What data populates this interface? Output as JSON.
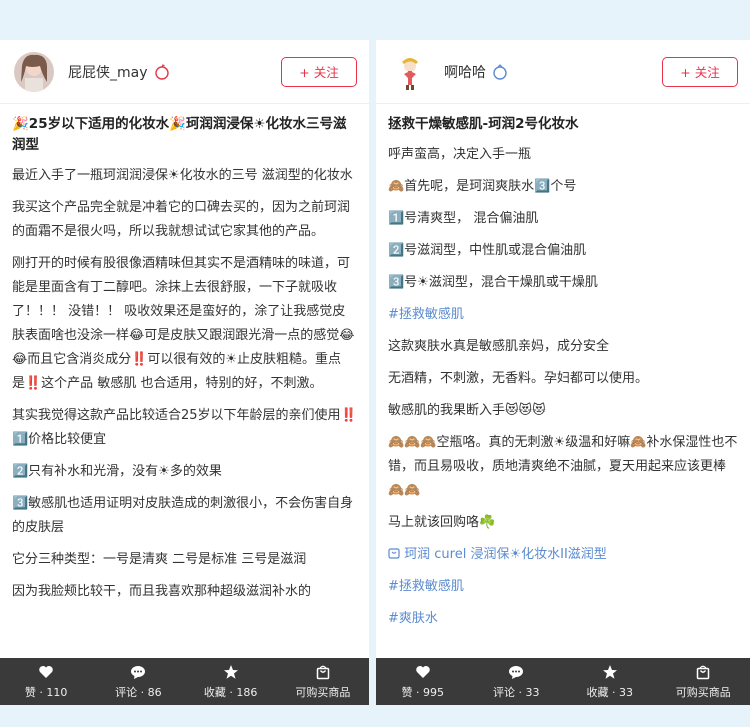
{
  "left": {
    "username": "屁屁侠_may",
    "follow_label": "+ 关注",
    "title": "🎉25岁以下适用的化妆水🎉珂润润浸保☀化妆水三号滋润型",
    "paragraphs": [
      "最近入手了一瓶珂润润浸保☀化妆水的三号 滋润型的化妆水",
      "我买这个产品完全就是冲着它的口碑去买的，因为之前珂润的面霜不是很火吗，所以我就想试试它家其他的产品。",
      "刚打开的时候有股很像酒精味但其实不是酒精味的味道，可能是里面含有丁二醇吧。涂抹上去很舒服，一下子就吸收了！！！ 没错！！ 吸收效果还是蛮好的，涂了让我感觉皮肤表面啥也没涂一样😂可是皮肤又跟润跟光滑一点的感觉😂😂而且它含消炎成分‼️可以很有效的☀止皮肤粗糙。重点是‼️这个产品 敏感肌 也合适用，特别的好，不刺激。",
      "其实我觉得这款产品比较适合25岁以下年龄层的亲们使用‼️1️⃣价格比较便宜",
      "2️⃣只有补水和光滑，没有☀多的效果",
      "3️⃣敏感肌也适用证明对皮肤造成的刺激很小，不会伤害自身的皮肤层",
      "它分三种类型：一号是清爽 二号是标准 三号是滋润",
      "因为我脸颊比较干，而且我喜欢那种超级滋润补水的"
    ],
    "footer": [
      {
        "icon": "heart-icon",
        "label": "赞 · 110"
      },
      {
        "icon": "comment-icon",
        "label": "评论 · 86"
      },
      {
        "icon": "star-icon",
        "label": "收藏 · 186"
      },
      {
        "icon": "shopping-bag-icon",
        "label": "可购买商品"
      }
    ]
  },
  "right": {
    "username": "啊哈哈",
    "follow_label": "+ 关注",
    "title": "拯救干燥敏感肌-珂润2号化妆水",
    "paragraphs": [
      "呼声蛮高，决定入手一瓶",
      "🙈首先呢，是珂润爽肤水3️⃣个号",
      "1️⃣号清爽型， 混合偏油肌",
      "2️⃣号滋润型，中性肌或混合偏油肌",
      "3️⃣号☀滋润型，混合干燥肌或干燥肌"
    ],
    "tag1": "#拯救敏感肌",
    "paragraphs2": [
      "这款爽肤水真是敏感肌亲妈，成分安全",
      "无酒精，不刺激，无香料。孕妇都可以使用。",
      "敏感肌的我果断入手😻😻😻",
      "🙈🙈🙈空瓶咯。真的无刺激☀级温和好嘛🙈补水保湿性也不错，而且易吸收，质地清爽绝不油腻，夏天用起来应该更棒🙈🙈",
      "马上就该回购咯☘️"
    ],
    "product_link": "珂润 curel 浸润保☀化妆水II滋润型",
    "tag2": "#拯救敏感肌",
    "tag3": "#爽肤水",
    "footer": [
      {
        "icon": "heart-icon",
        "label": "赞 · 995"
      },
      {
        "icon": "comment-icon",
        "label": "评论 · 33"
      },
      {
        "icon": "star-icon",
        "label": "收藏 · 33"
      },
      {
        "icon": "shopping-bag-icon",
        "label": "可购买商品"
      }
    ]
  },
  "colors": {
    "accent": "#e8334a",
    "tag": "#5b8bd0",
    "footer_bg": "#3a3a3a",
    "background": "#e7f3fb"
  }
}
